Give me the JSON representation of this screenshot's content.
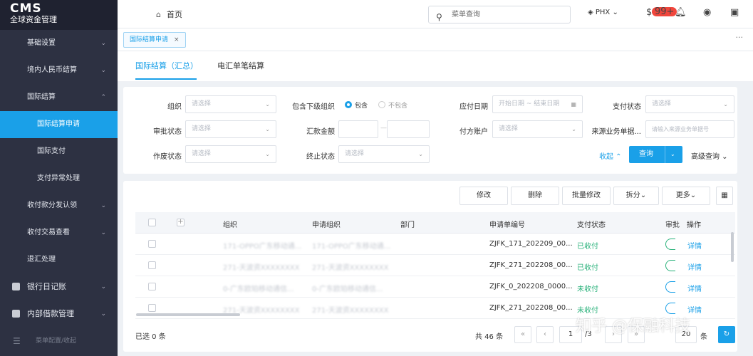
{
  "app": {
    "logo_main": "CMS",
    "logo_sub": "全球资金管理"
  },
  "sidebar": {
    "items": [
      {
        "label": "基础设置"
      },
      {
        "label": "境内人民币结算"
      },
      {
        "label": "国际结算"
      },
      {
        "label": "国际结算申请"
      },
      {
        "label": "国际支付"
      },
      {
        "label": "支付异常处理"
      },
      {
        "label": "收付款分发认领"
      },
      {
        "label": "收付交易查看"
      },
      {
        "label": "退汇处理"
      },
      {
        "label": "银行日记账"
      },
      {
        "label": "内部借款管理"
      },
      {
        "label": "菜单配置/收起"
      }
    ]
  },
  "topbar": {
    "home": "首页",
    "search_placeholder": "菜单查询",
    "org": "PHX",
    "badge": "99+"
  },
  "tabs": {
    "open_tab": "国际结算申请",
    "close": "×",
    "more": "···"
  },
  "subtabs": {
    "summary": "国际结算（汇总）",
    "single": "电汇单笔结算"
  },
  "filters": {
    "org_label": "组织",
    "org_ph": "请选择",
    "subset_label": "包含下级组织",
    "opt_yes": "包含",
    "opt_no": "不包含",
    "due_label": "应付日期",
    "due_ph": "开始日期 ~ 结束日期",
    "pay_status_label": "支付状态",
    "pay_status_ph": "请选择",
    "approve_label": "审批状态",
    "approve_ph": "请选择",
    "amount_label": "汇款金额",
    "amount_sep": "—",
    "account_label": "付方账户",
    "account_ph": "请选择",
    "src_label": "来源业务单据...",
    "src_ph": "请输入来源业务单据号",
    "void_label": "作废状态",
    "void_ph": "请选择",
    "stop_label": "终止状态",
    "stop_ph": "请选择",
    "collapse": "收起",
    "query": "查询",
    "advanced": "高级查询"
  },
  "toolbar": {
    "edit": "修改",
    "delete": "删除",
    "batch": "批量修改",
    "split": "拆分",
    "more": "更多"
  },
  "table": {
    "headers": [
      "组织",
      "申请组织",
      "部门",
      "申请单编号",
      "支付状态",
      "审批",
      "操作"
    ],
    "rows": [
      {
        "org": "171-OPPO广东移动通...",
        "apply_org": "171-OPPO广东移动通...",
        "dept": "",
        "no": "ZJFK_171_202209_00...",
        "status": "已收付",
        "action": "详情"
      },
      {
        "org": "271-天波资XXXXXXXX",
        "apply_org": "271-天波资XXXXXXXX",
        "dept": "",
        "no": "ZJFK_271_202208_00...",
        "status": "已收付",
        "action": "详情"
      },
      {
        "org": "0-广东欧珀移动通信...",
        "apply_org": "0-广东欧珀移动通信...",
        "dept": "",
        "no": "ZJFK_0_202208_0000...",
        "status": "未收付",
        "action": "详情"
      },
      {
        "org": "271-天波资XXXXXXXX",
        "apply_org": "271-天波资XXXXXXXX",
        "dept": "",
        "no": "ZJFK_271_202208_00...",
        "status": "未收付",
        "action": "详情"
      }
    ]
  },
  "footer": {
    "selected": "已选 0 条",
    "total": "共 46 条",
    "page": "1",
    "pages": "/3",
    "page_size": "20",
    "page_unit": "条"
  },
  "watermark": "知乎 @保融科技",
  "colors": {
    "accent": "#1aa0e8",
    "sidebar": "#2d3142",
    "success": "#2ab27b"
  }
}
